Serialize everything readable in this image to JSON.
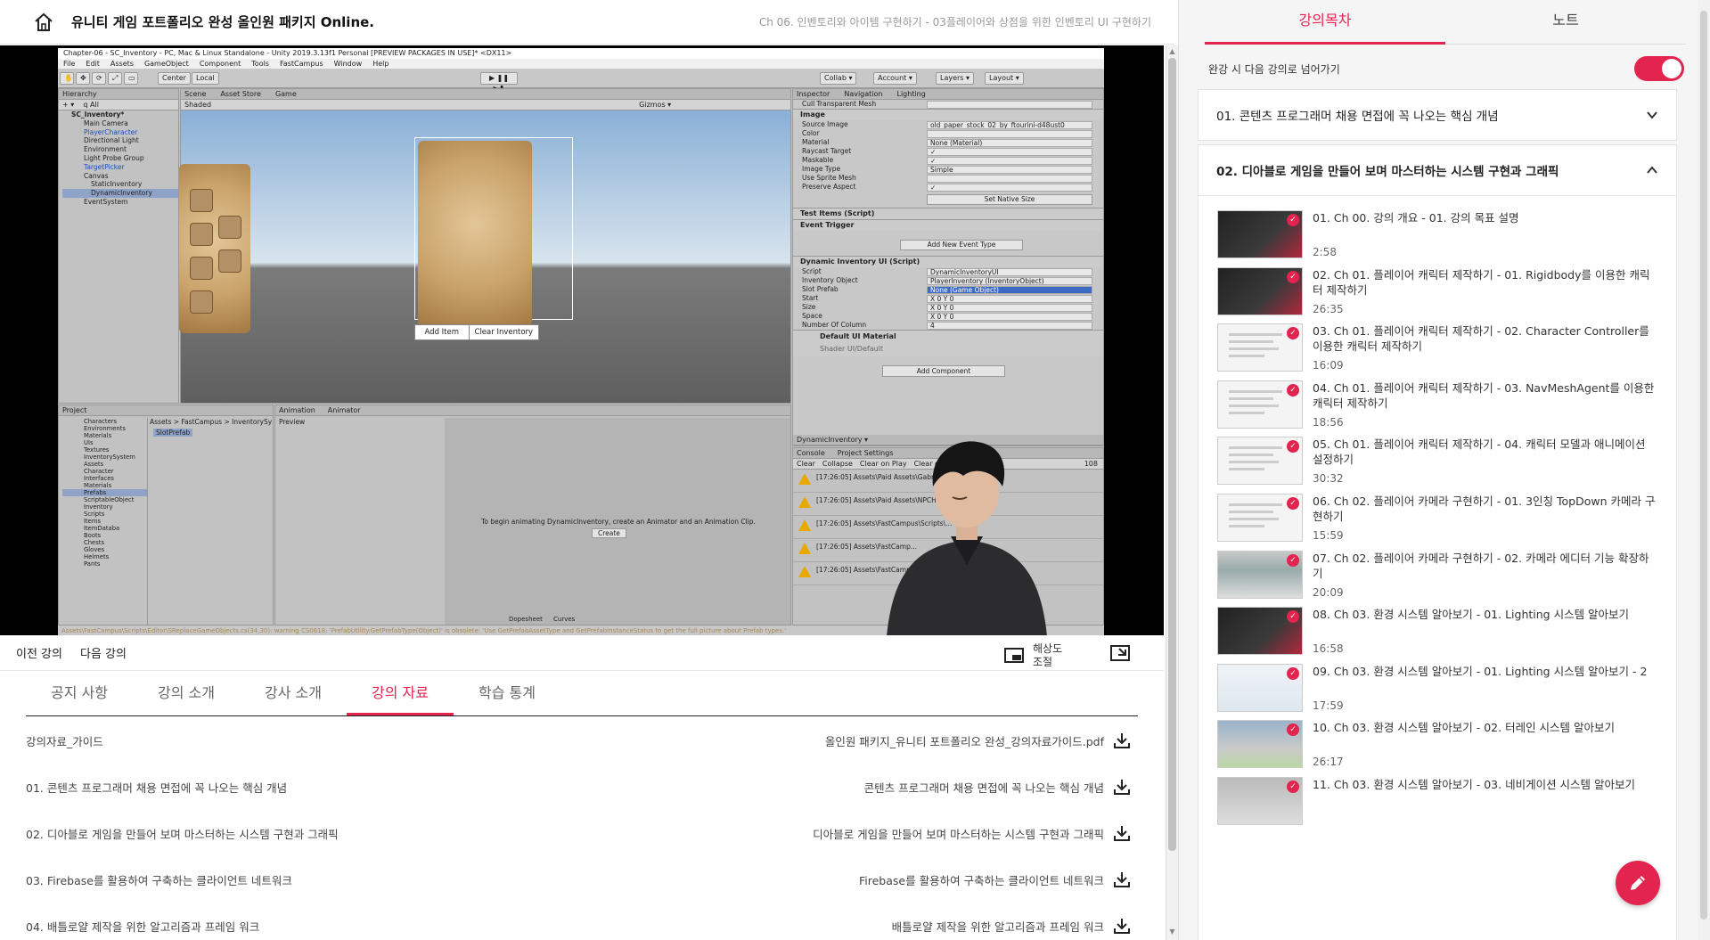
{
  "header": {
    "course_title": "유니티 게임 포트폴리오 완성 올인원 패키지 Online.",
    "breadcrumb": "Ch 06. 인벤토리와 아이템 구현하기 - 03플레이어와 상점을 위한 인벤토리 UI 구현하기"
  },
  "unity": {
    "window_title": "Chapter-06 - SC_Inventory - PC, Mac & Linux Standalone - Unity 2019.3.13f1 Personal [PREVIEW PACKAGES IN USE]* <DX11>",
    "menu": [
      "File",
      "Edit",
      "Assets",
      "GameObject",
      "Component",
      "Tools",
      "FastCampus",
      "Window",
      "Help"
    ],
    "toolbar": {
      "center": "Center",
      "local": "Local",
      "collab": "Collab ▾",
      "account": "Account ▾",
      "layers": "Layers ▾",
      "layout": "Layout ▾"
    },
    "hierarchy": {
      "tab": "Hierarchy",
      "items": [
        "SC_Inventory*",
        "Main Camera",
        "PlayerCharacter",
        "Directional Light",
        "Environment",
        "Light Probe Group",
        "TargetPicker",
        "Canvas",
        "StaticInventory",
        "DynamicInventory",
        "EventSystem"
      ]
    },
    "scene_tabs": [
      "Scene",
      "Asset Store",
      "Game"
    ],
    "scene_shading": "Shaded",
    "scene_gizmos": "Gizmos ▾",
    "scene_buttons": {
      "add": "Add Item",
      "clear": "Clear Inventory"
    },
    "inspector": {
      "tabs": [
        "Inspector",
        "Navigation",
        "Lighting"
      ],
      "rows_image": [
        {
          "k": "Cull Transparent Mesh",
          "v": ""
        },
        {
          "k": "Source Image",
          "v": "old_paper_stock_02_by_ftourini-d48ust0"
        },
        {
          "k": "Color",
          "v": ""
        },
        {
          "k": "Material",
          "v": "None (Material)"
        },
        {
          "k": "Raycast Target",
          "v": "✓"
        },
        {
          "k": "Maskable",
          "v": "✓"
        },
        {
          "k": "Image Type",
          "v": "Simple"
        },
        {
          "k": "Use Sprite Mesh",
          "v": ""
        },
        {
          "k": "Preserve Aspect",
          "v": "✓"
        }
      ],
      "image_header": "Image",
      "set_native": "Set Native Size",
      "test_items": "Test Items (Script)",
      "event_trigger": "Event Trigger",
      "add_event": "Add New Event Type",
      "dyn_header": "Dynamic Inventory UI (Script)",
      "rows_dyn": [
        {
          "k": "Script",
          "v": "DynamicInventoryUI"
        },
        {
          "k": "Inventory Object",
          "v": "PlayerInventory (InventoryObject)"
        },
        {
          "k": "Slot Prefab",
          "v": "None (Game Object)"
        },
        {
          "k": "Start",
          "v": "X 0      Y 0"
        },
        {
          "k": "Size",
          "v": "X 0      Y 0"
        },
        {
          "k": "Space",
          "v": "X 0      Y 0"
        },
        {
          "k": "Number Of Column",
          "v": "4"
        }
      ],
      "material": "Default UI Material",
      "shader": "Shader   UI/Default",
      "add_component": "Add Component",
      "footer": "DynamicInventory ▾"
    },
    "project": {
      "tab": "Project",
      "folders": [
        "Characters",
        "Environments",
        "Materials",
        "UIs",
        "Textures",
        "InventorySystem",
        "Assets",
        "Character",
        "Interfaces",
        "Materials",
        "Prefabs",
        "ScriptableObject",
        "Inventory",
        "Scripts",
        "Items",
        "ItemDataba",
        "Boots",
        "Chests",
        "Gloves",
        "Helmets",
        "Pants"
      ],
      "path": "Assets > FastCampus > InventorySy",
      "asset": "SlotPrefab"
    },
    "animation": {
      "tabs": [
        "Animation",
        "Animator"
      ],
      "preview": "Preview",
      "message": "To begin animating DynamicInventory, create an Animator and an Animation Clip.",
      "create": "Create",
      "bottom": [
        "Dopesheet",
        "Curves"
      ]
    },
    "console": {
      "tabs": [
        "Console",
        "Project Settings"
      ],
      "buttons": [
        "Clear",
        "Collapse",
        "Clear on Play",
        "Clear on Build"
      ],
      "count": "108",
      "lines": [
        "[17:26:05] Assets\\Paid Assets\\GabrielAguia...",
        "[17:26:05] Assets\\Paid Assets\\NPCHealthB...",
        "[17:26:05] Assets\\FastCampus\\Scripts\\...",
        "[17:26:05] Assets\\FastCamp...",
        "[17:26:05] Assets\\FastCamp..."
      ]
    },
    "status": "Assets\\FastCampus\\Scripts\\Editor\\SReplaceGameObjects.cs(34,30): warning CS0618: 'PrefabUtility.GetPrefabType(Object)' is obsolete: 'Use GetPrefabAssetType and GetPrefabInstanceStatus to get the full picture about Prefab types.'"
  },
  "player": {
    "prev": "이전 강의",
    "next": "다음 강의",
    "resolution": "해상도 조절"
  },
  "tabs": [
    "공지 사항",
    "강의 소개",
    "강사 소개",
    "강의 자료",
    "학습 통계"
  ],
  "materials": [
    {
      "left": "강의자료_가이드",
      "right": "올인원 패키지_유니티 포트폴리오 완성_강의자료가이드.pdf"
    },
    {
      "left": "01. 콘텐츠 프로그래머 채용 면접에 꼭 나오는 핵심 개념",
      "right": "콘텐츠 프로그래머 채용 면접에 꼭 나오는 핵심 개념"
    },
    {
      "left": "02. 디아블로 게임을 만들어 보며 마스터하는 시스템 구현과 그래픽",
      "right": "디아블로 게임을 만들어 보며 마스터하는 시스템 구현과 그래픽"
    },
    {
      "left": "03. Firebase를 활용하여 구축하는 클라이언트 네트워크",
      "right": "Firebase를 활용하여 구축하는 클라이언트 네트워크"
    },
    {
      "left": "04. 배틀로얄 제작을 위한 알고리즘과 프레임 워크",
      "right": "배틀로얄 제작을 위한 알고리즘과 프레임 워크"
    }
  ],
  "sidebar": {
    "tabs": [
      "강의목차",
      "노트"
    ],
    "autoplay_label": "완강 시 다음 강의로 넘어가기",
    "section1": "01. 콘텐츠 프로그래머 채용 면접에 꼭 나오는 핵심 개념",
    "section2": "02. 디아블로 게임을 만들어 보며 마스터하는 시스템 구현과 그래픽",
    "lectures": [
      {
        "title": "01. Ch 00. 강의 개요 - 01. 강의 목표 설명",
        "time": "2:58"
      },
      {
        "title": "02. Ch 01. 플레이어 캐릭터 제작하기 - 01. Rigidbody를 이용한 캐릭터 제작하기",
        "time": "26:35"
      },
      {
        "title": "03. Ch 01. 플레이어 캐릭터 제작하기 - 02. Character Controller를 이용한 캐릭터 제작하기",
        "time": "16:09"
      },
      {
        "title": "04. Ch 01. 플레이어 캐릭터 제작하기 - 03. NavMeshAgent를 이용한 캐릭터 제작하기",
        "time": "18:56"
      },
      {
        "title": "05. Ch 01. 플레이어 캐릭터 제작하기 - 04. 캐릭터 모델과 애니메이션 설정하기",
        "time": "30:32"
      },
      {
        "title": "06. Ch 02. 플레이어 카메라 구현하기 - 01. 3인칭 TopDown 카메라 구현하기",
        "time": "15:59"
      },
      {
        "title": "07. Ch 02. 플레이어 카메라 구현하기 - 02. 카메라 에디터 기능 확장하기",
        "time": "20:09"
      },
      {
        "title": "08. Ch 03. 환경 시스템 알아보기 - 01. Lighting 시스템 알아보기",
        "time": "16:58"
      },
      {
        "title": "09. Ch 03. 환경 시스템 알아보기 - 01. Lighting 시스템 알아보기 - 2",
        "time": "17:59"
      },
      {
        "title": "10. Ch 03. 환경 시스템 알아보기 - 02. 터레인 시스템 알아보기",
        "time": "26:17"
      },
      {
        "title": "11. Ch 03. 환경 시스템 알아보기 - 03. 네비게이션 시스템 알아보기",
        "time": ""
      }
    ]
  },
  "colors": {
    "accent": "#e2244f"
  }
}
